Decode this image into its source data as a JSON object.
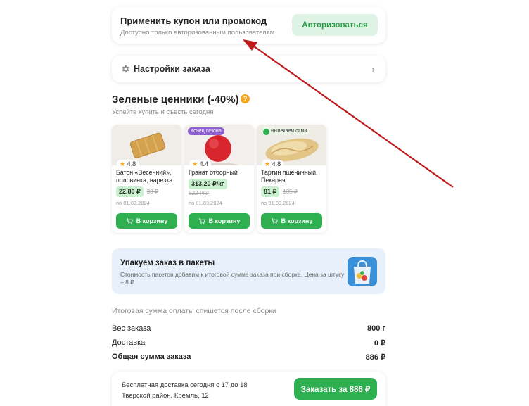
{
  "coupon": {
    "title": "Применить купон или промокод",
    "subtitle": "Доступно только авторизованным пользователям",
    "button": "Авторизоваться"
  },
  "settings": {
    "label": "Настройки заказа",
    "chevron": "›"
  },
  "green_prices": {
    "title": "Зеленые ценники (-40%)",
    "help": "?",
    "subtitle": "Успейте купить и съесть сегодня",
    "products": [
      {
        "rating": "4.8",
        "name": "Батон «Весенний», половинка, нарезка",
        "price": "22.80 ₽",
        "old_price": "38 ₽",
        "date": "по 01.03.2024",
        "button": "В корзину",
        "tag": ""
      },
      {
        "rating": "4.4",
        "name": "Гранат отборный",
        "price": "313.20 ₽/кг",
        "old_price": "522 ₽/кг",
        "date": "по 01.03.2024",
        "button": "В корзину",
        "tag": "Конец сезона"
      },
      {
        "rating": "4.8",
        "name": "Тартин пшеничный. Пекарня",
        "price": "81 ₽",
        "old_price": "135 ₽",
        "date": "по 01.03.2024",
        "button": "В корзину",
        "tag": "Выпекаем сами"
      }
    ]
  },
  "bags": {
    "title": "Упакуем заказ в пакеты",
    "desc": "Стоимость пакетов добавим к итоговой сумме заказа при сборке. Цена за штуку – 8 ₽"
  },
  "summary": {
    "note": "Итоговая сумма оплаты спишется после сборки",
    "weight_label": "Вес заказа",
    "weight_value": "800 г",
    "delivery_label": "Доставка",
    "delivery_value": "0 ₽",
    "total_label": "Общая сумма заказа",
    "total_value": "886 ₽"
  },
  "bottom": {
    "line1": "Бесплатная доставка сегодня с 17 до 18",
    "line2": "Тверской район, Кремль, 12",
    "order_button": "Заказать за 886 ₽"
  },
  "colors": {
    "accent": "#2eb050",
    "accent_light": "#dff3e4",
    "arrow": "#c0191b",
    "season_tag": "#8e5fd1"
  }
}
